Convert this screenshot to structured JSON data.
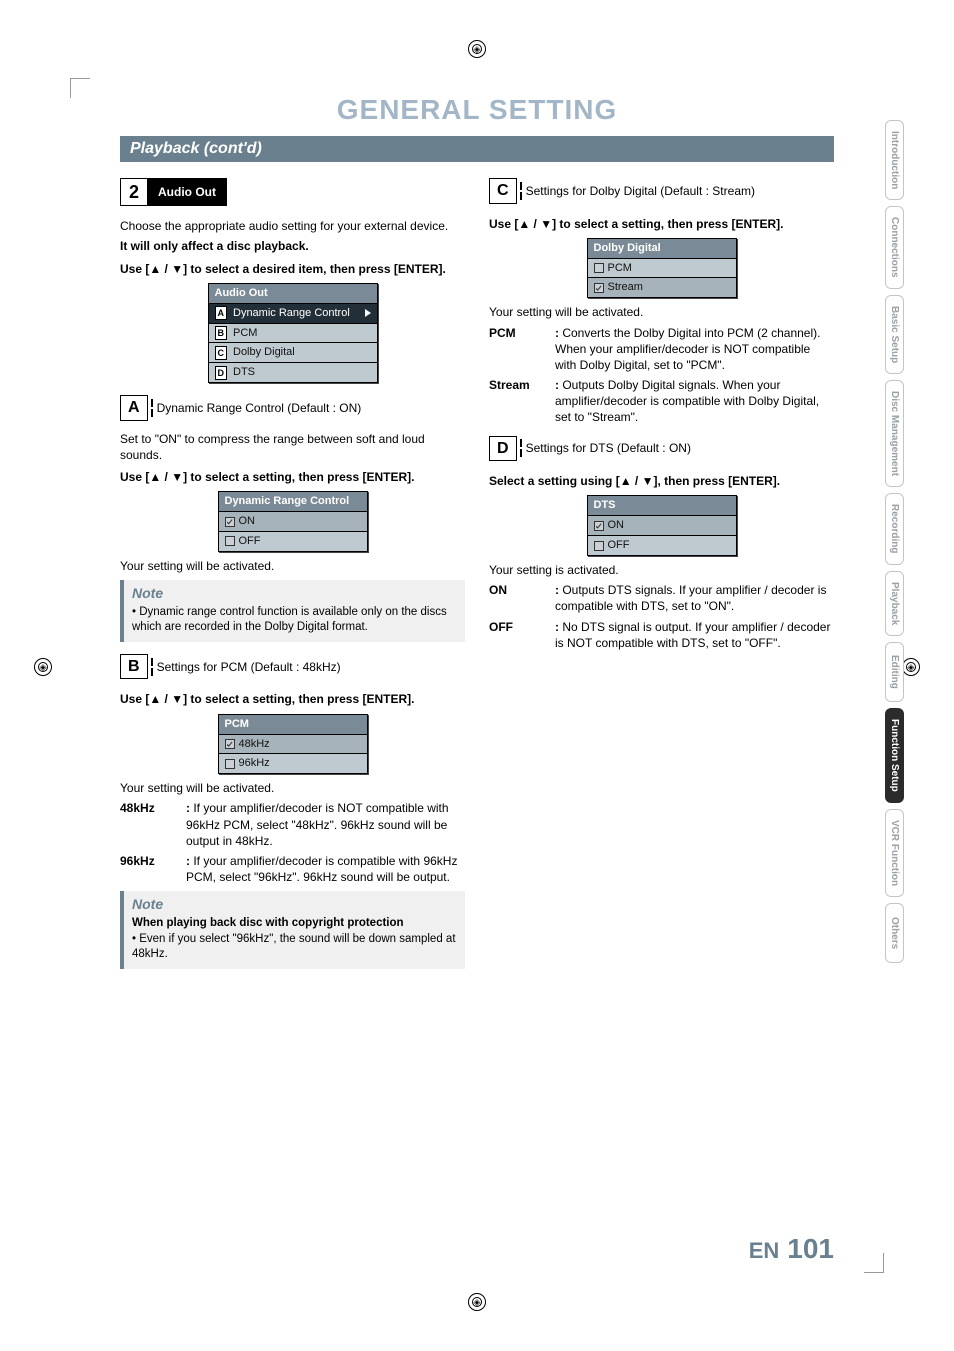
{
  "page_title": "GENERAL SETTING",
  "section_bar": "Playback (cont'd)",
  "side_tabs": [
    {
      "label": "Introduction",
      "active": false
    },
    {
      "label": "Connections",
      "active": false
    },
    {
      "label": "Basic Setup",
      "active": false
    },
    {
      "label": "Disc Management",
      "active": false
    },
    {
      "label": "Recording",
      "active": false
    },
    {
      "label": "Playback",
      "active": false
    },
    {
      "label": "Editing",
      "active": false
    },
    {
      "label": "Function Setup",
      "active": true
    },
    {
      "label": "VCR Function",
      "active": false
    },
    {
      "label": "Others",
      "active": false
    }
  ],
  "step2": {
    "num": "2",
    "label": "Audio Out",
    "intro1": "Choose the appropriate audio setting for your external device.",
    "intro2_bold": "It will only affect a disc playback.",
    "use_line": "Use [▲ / ▼] to select a desired item, then press [ENTER].",
    "menu": {
      "title": "Audio Out",
      "items": [
        {
          "letter": "A",
          "label": "Dynamic Range Control",
          "hl": true
        },
        {
          "letter": "B",
          "label": "PCM"
        },
        {
          "letter": "C",
          "label": "Dolby Digital"
        },
        {
          "letter": "D",
          "label": "DTS"
        }
      ]
    }
  },
  "A": {
    "chip_letter": "A",
    "chip_text": "Dynamic Range Control (Default : ON)",
    "p1": "Set to \"ON\" to compress the range between soft and loud sounds.",
    "use_line": "Use [▲ / ▼] to select a setting, then press [ENTER].",
    "menu": {
      "title": "Dynamic Range Control",
      "items": [
        {
          "label": "ON",
          "checked": true
        },
        {
          "label": "OFF",
          "checked": false
        }
      ]
    },
    "after": "Your setting will be activated.",
    "note_head": "Note",
    "note_item": "Dynamic range control function is available only on the discs which are recorded in the Dolby Digital format."
  },
  "B": {
    "chip_letter": "B",
    "chip_text": "Settings for PCM (Default : 48kHz)",
    "use_line": "Use [▲ / ▼] to select a setting, then press [ENTER].",
    "menu": {
      "title": "PCM",
      "items": [
        {
          "label": "48kHz",
          "checked": true
        },
        {
          "label": "96kHz",
          "checked": false
        }
      ]
    },
    "after": "Your setting will be activated.",
    "desc": [
      {
        "k": "48kHz",
        "v": "If your amplifier/decoder is NOT compatible with 96kHz PCM, select \"48kHz\". 96kHz sound will be output in 48kHz."
      },
      {
        "k": "96kHz",
        "v": "If your amplifier/decoder is compatible with 96kHz PCM, select \"96kHz\". 96kHz sound will be output."
      }
    ],
    "note_head": "Note",
    "note_bold": "When playing back disc with copyright protection",
    "note_item": "Even if you select \"96kHz\", the sound will be down sampled at 48kHz."
  },
  "C": {
    "chip_letter": "C",
    "chip_text": "Settings for Dolby Digital (Default : Stream)",
    "use_line": "Use [▲ / ▼] to select a setting, then press [ENTER].",
    "menu": {
      "title": "Dolby Digital",
      "items": [
        {
          "label": "PCM",
          "checked": false
        },
        {
          "label": "Stream",
          "checked": true
        }
      ]
    },
    "after": "Your setting will be activated.",
    "desc": [
      {
        "k": "PCM",
        "v": "Converts the Dolby Digital into PCM (2 channel). When your amplifier/decoder is NOT compatible with Dolby Digital, set to \"PCM\"."
      },
      {
        "k": "Stream",
        "v": "Outputs Dolby Digital signals. When your amplifier/decoder is compatible with Dolby Digital, set to \"Stream\"."
      }
    ]
  },
  "D": {
    "chip_letter": "D",
    "chip_text": "Settings for DTS (Default : ON)",
    "use_line": "Select a setting using [▲ / ▼], then press [ENTER].",
    "menu": {
      "title": "DTS",
      "items": [
        {
          "label": "ON",
          "checked": true
        },
        {
          "label": "OFF",
          "checked": false
        }
      ]
    },
    "after": "Your setting is activated.",
    "desc": [
      {
        "k": "ON",
        "v": "Outputs DTS signals. If your amplifier / decoder is compatible with DTS, set to \"ON\"."
      },
      {
        "k": "OFF",
        "v": "No DTS signal is output. If your amplifier / decoder is NOT compatible with DTS, set to \"OFF\"."
      }
    ]
  },
  "footer": {
    "lang": "EN",
    "page": "101"
  }
}
